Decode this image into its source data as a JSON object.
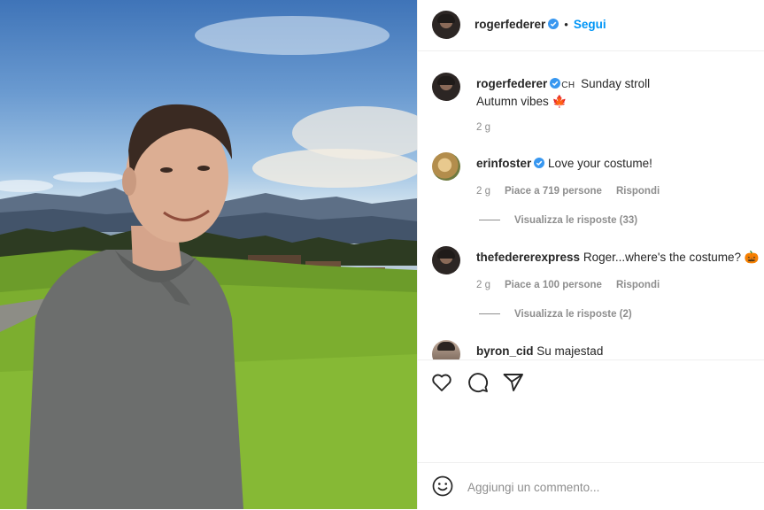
{
  "post": {
    "author": "rogerfederer",
    "follow_label": "Segui",
    "separator": "•"
  },
  "caption": {
    "author": "rogerfederer",
    "location_tag": "CH",
    "line1": "Sunday stroll",
    "line2": "Autumn vibes",
    "line2_emoji": "🍁",
    "age": "2 g"
  },
  "comments": [
    {
      "author": "erinfoster",
      "verified": true,
      "text": "Love your costume!",
      "age": "2 g",
      "likes": "Piace a 719 persone",
      "reply_label": "Rispondi",
      "view_replies": "Visualizza le risposte (33)"
    },
    {
      "author": "thefedererexpress",
      "verified": false,
      "text": "Roger...where's the costume?",
      "emoji": "🎃",
      "age": "2 g",
      "likes": "Piace a 100 persone",
      "reply_label": "Rispondi",
      "view_replies": "Visualizza le risposte (2)"
    },
    {
      "author": "byron_cid",
      "verified": false,
      "text": "Su majestad"
    }
  ],
  "add_comment": {
    "placeholder": "Aggiungi un commento..."
  },
  "icons": {
    "like": "heart-icon",
    "comment": "speech-bubble-icon",
    "share": "paper-plane-icon",
    "emoji": "smiley-icon",
    "verified": "verified-badge-icon"
  },
  "colors": {
    "link_blue": "#0095f6",
    "verified_blue": "#3897f0",
    "muted_text": "#8e8e8e"
  }
}
